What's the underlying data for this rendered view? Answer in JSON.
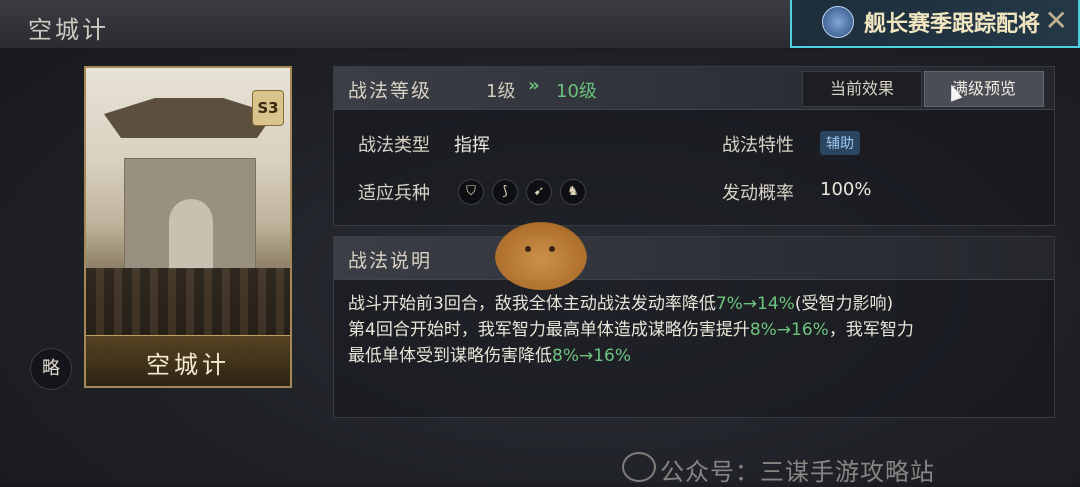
{
  "header": {
    "title": "空城计"
  },
  "event_banner": {
    "text": "舰长赛季跟踪配将"
  },
  "card": {
    "name": "空城计",
    "badge": "S3"
  },
  "side_button": {
    "label": "略"
  },
  "level": {
    "label": "战法等级",
    "from": "1级",
    "arrow": "»",
    "to": "10级"
  },
  "tabs": [
    {
      "label": "当前效果",
      "active": false
    },
    {
      "label": "满级预览",
      "active": true
    }
  ],
  "attributes": {
    "type_label": "战法类型",
    "type_value": "指挥",
    "trait_label": "战法特性",
    "trait_value": "辅助",
    "troops_label": "适应兵种",
    "troops_icons": [
      "shield-icon",
      "bow-icon",
      "spear-icon",
      "horse-icon"
    ],
    "prob_label": "发动概率",
    "prob_value": "100%"
  },
  "description": {
    "title": "战法说明",
    "line1_a": "战斗开始前3回合，敌我全体主动战法发动率降低",
    "line1_hl": "7%→14%",
    "line1_b": "(受智力影响)",
    "line2_a": "第4回合开始时，我军智力最高单体造成谋略伤害提升",
    "line2_hl": "8%→16%",
    "line2_b": "，我军智力",
    "line3_a": "最低单体受到谋略伤害降低",
    "line3_hl": "8%→16%"
  },
  "watermark": {
    "text": "公众号：三谋手游攻略站"
  },
  "colors": {
    "highlight": "#6ec47e",
    "accent_border": "#4fd0e0"
  }
}
